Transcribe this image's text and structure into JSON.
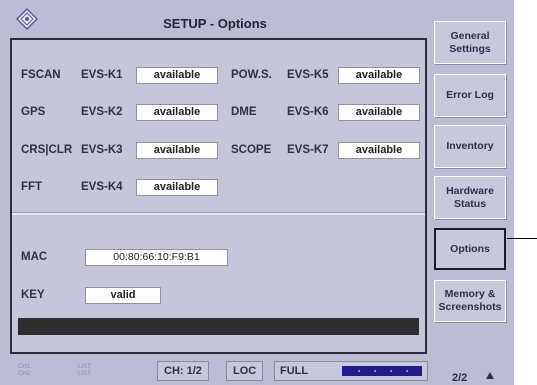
{
  "header": {
    "title": "SETUP - Options",
    "logo_icon": "rohde-schwarz-diamond-logo"
  },
  "options": [
    {
      "name": "FSCAN",
      "code": "EVS-K1",
      "status": "available"
    },
    {
      "name": "GPS",
      "code": "EVS-K2",
      "status": "available"
    },
    {
      "name": "CRS|CLR",
      "code": "EVS-K3",
      "status": "available"
    },
    {
      "name": "FFT",
      "code": "EVS-K4",
      "status": "available"
    },
    {
      "name": "POW.S.",
      "code": "EVS-K5",
      "status": "available"
    },
    {
      "name": "DME",
      "code": "EVS-K6",
      "status": "available"
    },
    {
      "name": "SCOPE",
      "code": "EVS-K7",
      "status": "available"
    }
  ],
  "mac": {
    "label": "MAC",
    "value": "00:80:66:10:F9:B1"
  },
  "key": {
    "label": "KEY",
    "value": "valid"
  },
  "sidebar": [
    {
      "label": "General Settings"
    },
    {
      "label": "Error Log"
    },
    {
      "label": "Inventory"
    },
    {
      "label": "Hardware Status"
    },
    {
      "label": "Options"
    },
    {
      "label": "Memory & Screenshots"
    }
  ],
  "footer": {
    "ch1": "CH1:",
    "ch2": "CH2:",
    "list1": "LIST:",
    "list2": "LIST:",
    "channel": "CH: 1/2",
    "loc": "LOC",
    "full": "FULL",
    "page": "2/2"
  },
  "colors": {
    "background": "#bcbcd4",
    "status_bar": "#2e2e2e",
    "meter": "#1e1e8a"
  }
}
